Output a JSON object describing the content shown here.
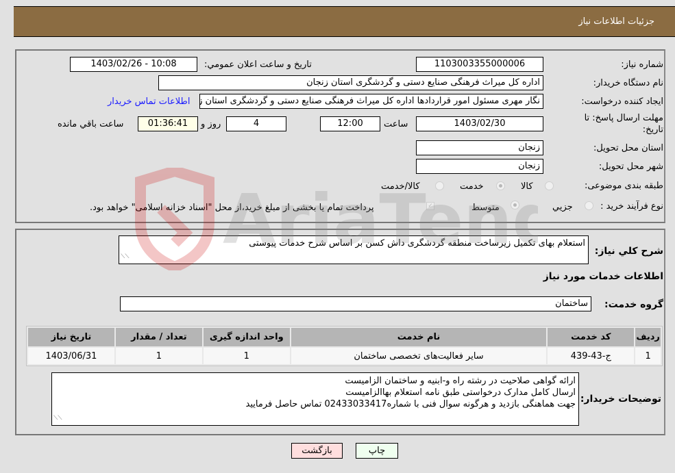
{
  "header": {
    "title": "جزئیات اطلاعات نیاز"
  },
  "form": {
    "need_number": {
      "label": "شماره نیاز:",
      "value": "1103003355000006"
    },
    "announce_datetime": {
      "label": "تاريخ و ساعت اعلان عمومي:",
      "value": "1403/02/26 - 10:08"
    },
    "buyer_org": {
      "label": "نام دستگاه خريدار:",
      "value": "اداره کل میراث فرهنگی  صنایع دستی و گردشگری استان زنجان"
    },
    "requester": {
      "label": "ايجاد کننده درخواست:",
      "value": "نگار مهری مسئول امور قراردادها اداره کل میراث فرهنگی  صنایع دستی و گردشگری استان زنجان"
    },
    "buyer_contact_link": "اطلاعات تماس خريدار",
    "deadline": {
      "label_line1": "مهلت ارسال پاسخ: تا",
      "label_line2": "تاريخ:",
      "date": "1403/02/30",
      "time_label": "ساعت",
      "time": "12:00",
      "days": "4",
      "days_label": "روز و",
      "remaining": "01:36:41",
      "remaining_label": "ساعت باقي مانده"
    },
    "province": {
      "label": "استان محل تحويل:",
      "value": "زنجان"
    },
    "city": {
      "label": "شهر محل تحويل:",
      "value": "زنجان"
    },
    "category": {
      "label": "طبقه بندی موضوعی:",
      "options": [
        "کالا",
        "خدمت",
        "کالا/خدمت"
      ],
      "selected": "خدمت"
    },
    "purchase_type": {
      "label": "نوع فرآيند خريد :",
      "options": [
        "جزيي",
        "متوسط"
      ],
      "selected": "متوسط",
      "treasury_note": "پرداخت تمام يا بخشی از مبلغ خريد،از محل \"اسناد خزانه اسلامی\" خواهد بود.",
      "treasury_checked": true
    }
  },
  "details": {
    "summary_label": "شرح کلي نياز:",
    "summary_value": "استعلام بهای تکمیل زیرساخت منطقه گردشگری داش کسن بر اساس شرح خدمات پیوستی",
    "services_heading": "اطلاعات خدمات مورد نياز",
    "service_group_label": "گروه خدمت:",
    "service_group_value": "ساختمان",
    "table": {
      "headers": [
        "رديف",
        "کد خدمت",
        "نام خدمت",
        "واحد اندازه گيری",
        "تعداد / مقدار",
        "تاريخ نياز"
      ],
      "rows": [
        [
          "1",
          "ج-43-439",
          "سایر فعالیت‌های تخصصی ساختمان",
          "1",
          "1",
          "1403/06/31"
        ]
      ]
    },
    "buyer_notes_label": "توضيحات خريدار:",
    "buyer_notes_lines": [
      "ارائه گواهی صلاحیت در رشته راه و-ابنیه و ساختمان الزامیست",
      "ارسال کامل مدارک درخواستی طبق نامه استعلام بهاالزامیست",
      "جهت هماهنگی بازدید و هرگونه سوال فنی با شماره02433033417 تماس حاصل فرمایید"
    ]
  },
  "buttons": {
    "print": "چاپ",
    "back": "بازگشت"
  },
  "watermark": {
    "text": "AriaTender.neT"
  }
}
